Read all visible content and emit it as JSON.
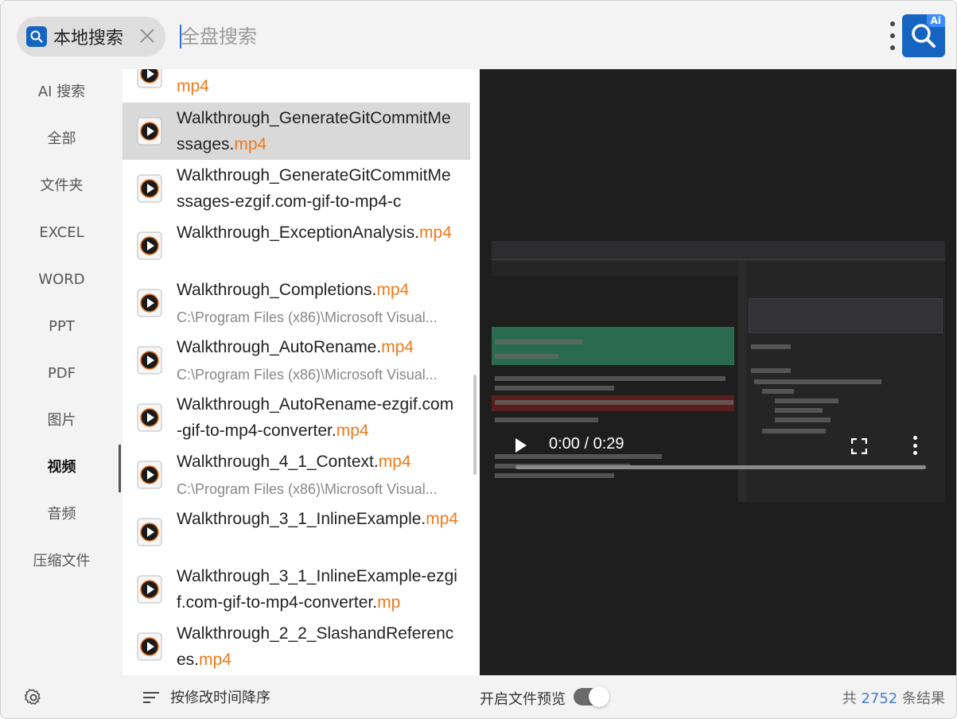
{
  "header": {
    "scope_label": "本地搜索",
    "search_placeholder": "全盘搜索",
    "ai_badge": "Ai"
  },
  "sidebar": {
    "items": [
      {
        "label": "AI 搜索",
        "active": false
      },
      {
        "label": "全部",
        "active": false
      },
      {
        "label": "文件夹",
        "active": false
      },
      {
        "label": "EXCEL",
        "active": false
      },
      {
        "label": "WORD",
        "active": false
      },
      {
        "label": "PPT",
        "active": false
      },
      {
        "label": "PDF",
        "active": false
      },
      {
        "label": "图片",
        "active": false
      },
      {
        "label": "视频",
        "active": true
      },
      {
        "label": "音频",
        "active": false
      },
      {
        "label": "压缩文件",
        "active": false
      }
    ]
  },
  "results": [
    {
      "name": "",
      "ext": "mp4",
      "path": "",
      "selected": false
    },
    {
      "name": "Walkthrough_GenerateGitCommitMessages.",
      "ext": "mp4",
      "path": "",
      "selected": true
    },
    {
      "name": "Walkthrough_GenerateGitCommitMessages-ezgif.com-gif-to-mp4-c",
      "ext": "",
      "path": "",
      "selected": false
    },
    {
      "name": "Walkthrough_ExceptionAnalysis.",
      "ext": "mp4",
      "path": "",
      "selected": false
    },
    {
      "name": "Walkthrough_Completions.",
      "ext": "mp4",
      "path": "C:\\Program Files (x86)\\Microsoft Visual...",
      "selected": false
    },
    {
      "name": "Walkthrough_AutoRename.",
      "ext": "mp4",
      "path": "C:\\Program Files (x86)\\Microsoft Visual...",
      "selected": false
    },
    {
      "name": "Walkthrough_AutoRename-ezgif.com-gif-to-mp4-converter.",
      "ext": "mp4",
      "path": "",
      "selected": false
    },
    {
      "name": "Walkthrough_4_1_Context.",
      "ext": "mp4",
      "path": "C:\\Program Files (x86)\\Microsoft Visual...",
      "selected": false
    },
    {
      "name": "Walkthrough_3_1_InlineExample.",
      "ext": "mp4",
      "path": "",
      "selected": false
    },
    {
      "name": "Walkthrough_3_1_InlineExample-ezgif.com-gif-to-mp4-converter.",
      "ext": "mp",
      "path": "",
      "selected": false
    },
    {
      "name": "Walkthrough_2_2_SlashandReferences.",
      "ext": "mp4",
      "path": "",
      "selected": false
    }
  ],
  "preview": {
    "time": "0:00 / 0:29"
  },
  "footer": {
    "sort_label": "按修改时间降序",
    "preview_label": "开启文件预览",
    "preview_enabled": true,
    "count_prefix": "共",
    "count_value": "2752",
    "count_suffix": "条结果"
  }
}
